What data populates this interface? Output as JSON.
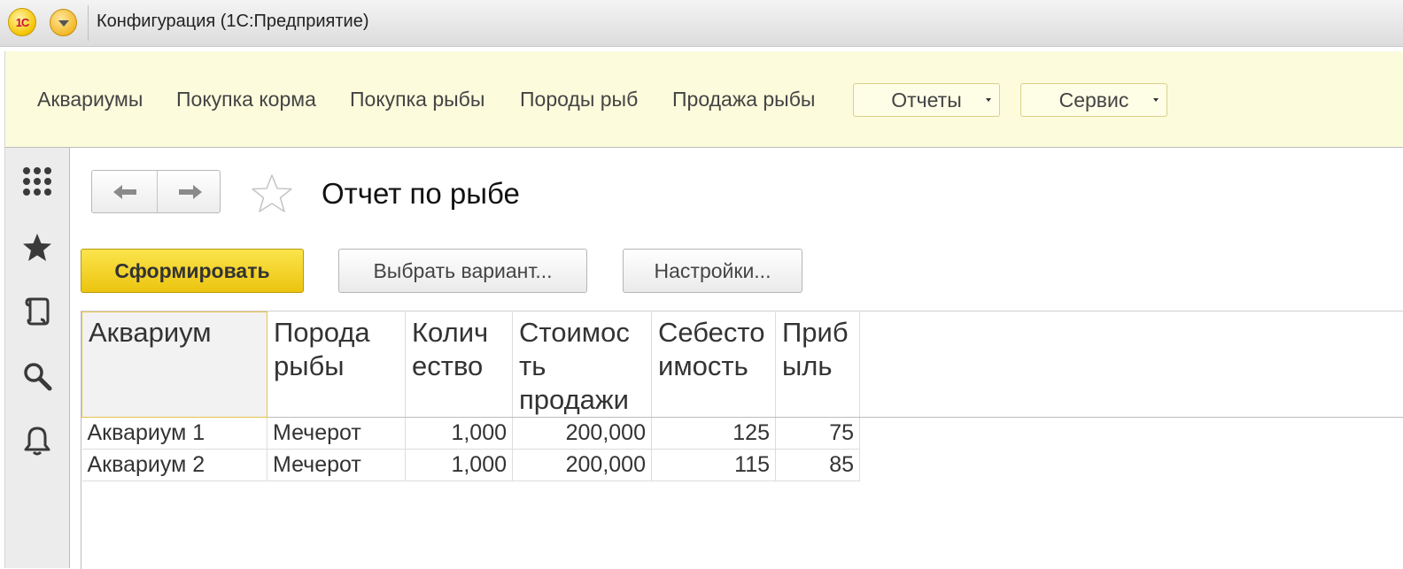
{
  "window": {
    "title": "Конфигурация  (1С:Предприятие)",
    "logo_text": "1С"
  },
  "sections": {
    "items": [
      "Аквариумы",
      "Покупка корма",
      "Покупка рыбы",
      "Породы рыб",
      "Продажа рыбы"
    ],
    "dropdowns": [
      "Отчеты",
      "Сервис"
    ]
  },
  "leftbar": {
    "icons": [
      "apps-grid-icon",
      "favorites-star-icon",
      "history-scroll-icon",
      "search-icon",
      "notifications-bell-icon"
    ]
  },
  "form": {
    "title": "Отчет по рыбе",
    "buttons": {
      "generate": "Сформировать",
      "choose_variant": "Выбрать вариант...",
      "settings": "Настройки..."
    }
  },
  "report": {
    "columns": [
      "Аквариум",
      "Порода рыбы",
      "Количество",
      "Стоимость продажи",
      "Себестоимость",
      "Прибыль"
    ],
    "column_header_lines": [
      [
        "Аквариум"
      ],
      [
        "Порода",
        "рыбы"
      ],
      [
        "Колич",
        "ество"
      ],
      [
        "Стоимос",
        "ть",
        "продажи"
      ],
      [
        "Себесто",
        "имость"
      ],
      [
        "Приб",
        "ыль"
      ]
    ],
    "rows": [
      [
        "Аквариум 1",
        "Мечерот",
        "1,000",
        "200,000",
        "125",
        "75"
      ],
      [
        "Аквариум 2",
        "Мечерот",
        "1,000",
        "200,000",
        "115",
        "85"
      ]
    ]
  },
  "colors": {
    "sections_bg": "#fcfbdc",
    "primary_button": "#f3d22a",
    "accent_border": "#e8c24a"
  }
}
